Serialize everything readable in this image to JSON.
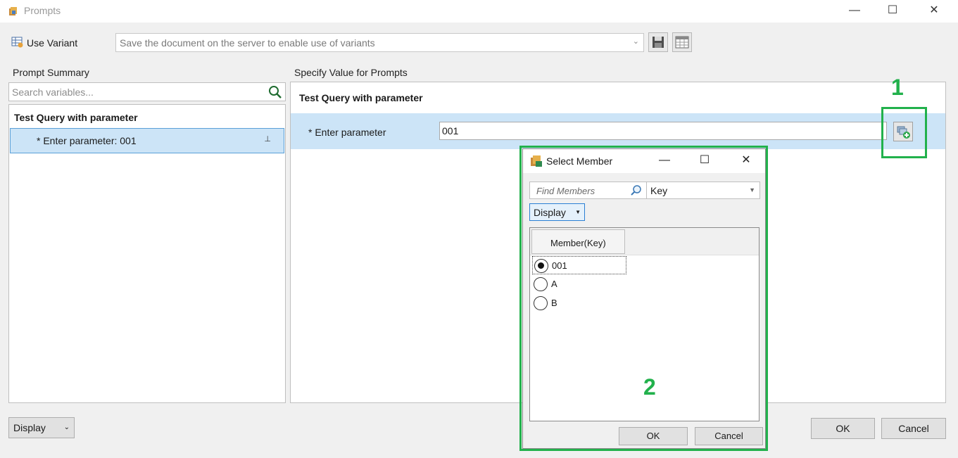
{
  "window": {
    "title": "Prompts",
    "minimize": "—",
    "maximize": "☐",
    "close": "✕"
  },
  "variant": {
    "label": "Use Variant",
    "placeholder": "Save the document on the server to enable use of variants",
    "dropdown_arrow": "⌄"
  },
  "left": {
    "section_label": "Prompt Summary",
    "search_placeholder": "Search variables...",
    "group_title": "Test Query with parameter",
    "items": [
      {
        "label": "* Enter parameter: 001",
        "pin": "⊥"
      }
    ]
  },
  "right": {
    "section_label": "Specify Value for Prompts",
    "group_title": "Test Query with parameter",
    "param_label": "* Enter parameter",
    "param_value": "001"
  },
  "footer": {
    "display_label": "Display",
    "display_arrow": "⌄",
    "ok_label": "OK",
    "cancel_label": "Cancel"
  },
  "callouts": {
    "one": "1",
    "two": "2",
    "color": "#22b14c"
  },
  "dialog": {
    "title": "Select Member",
    "minimize": "—",
    "maximize": "☐",
    "close": "✕",
    "find_placeholder": "Find Members",
    "key_value": "Key",
    "key_arrow": "▼",
    "display_label": "Display",
    "display_arrow": "▼",
    "column_header": "Member(Key)",
    "members": [
      {
        "label": "001",
        "selected": true
      },
      {
        "label": "A",
        "selected": false
      },
      {
        "label": "B",
        "selected": false
      }
    ],
    "ok_label": "OK",
    "cancel_label": "Cancel"
  },
  "icons": {
    "title": "prompts-app-icon",
    "variant": "variant-grid-icon",
    "save": "save-icon",
    "table": "table-icon",
    "search": "search-icon",
    "pin": "pin-icon",
    "member_picker": "member-picker-icon",
    "find": "magnifier-icon",
    "dialog": "select-member-icon"
  },
  "colors": {
    "selection": "#cce4f7",
    "selection_border": "#5aa0d8",
    "accent": "#2a7fd4",
    "callout": "#22b14c"
  }
}
